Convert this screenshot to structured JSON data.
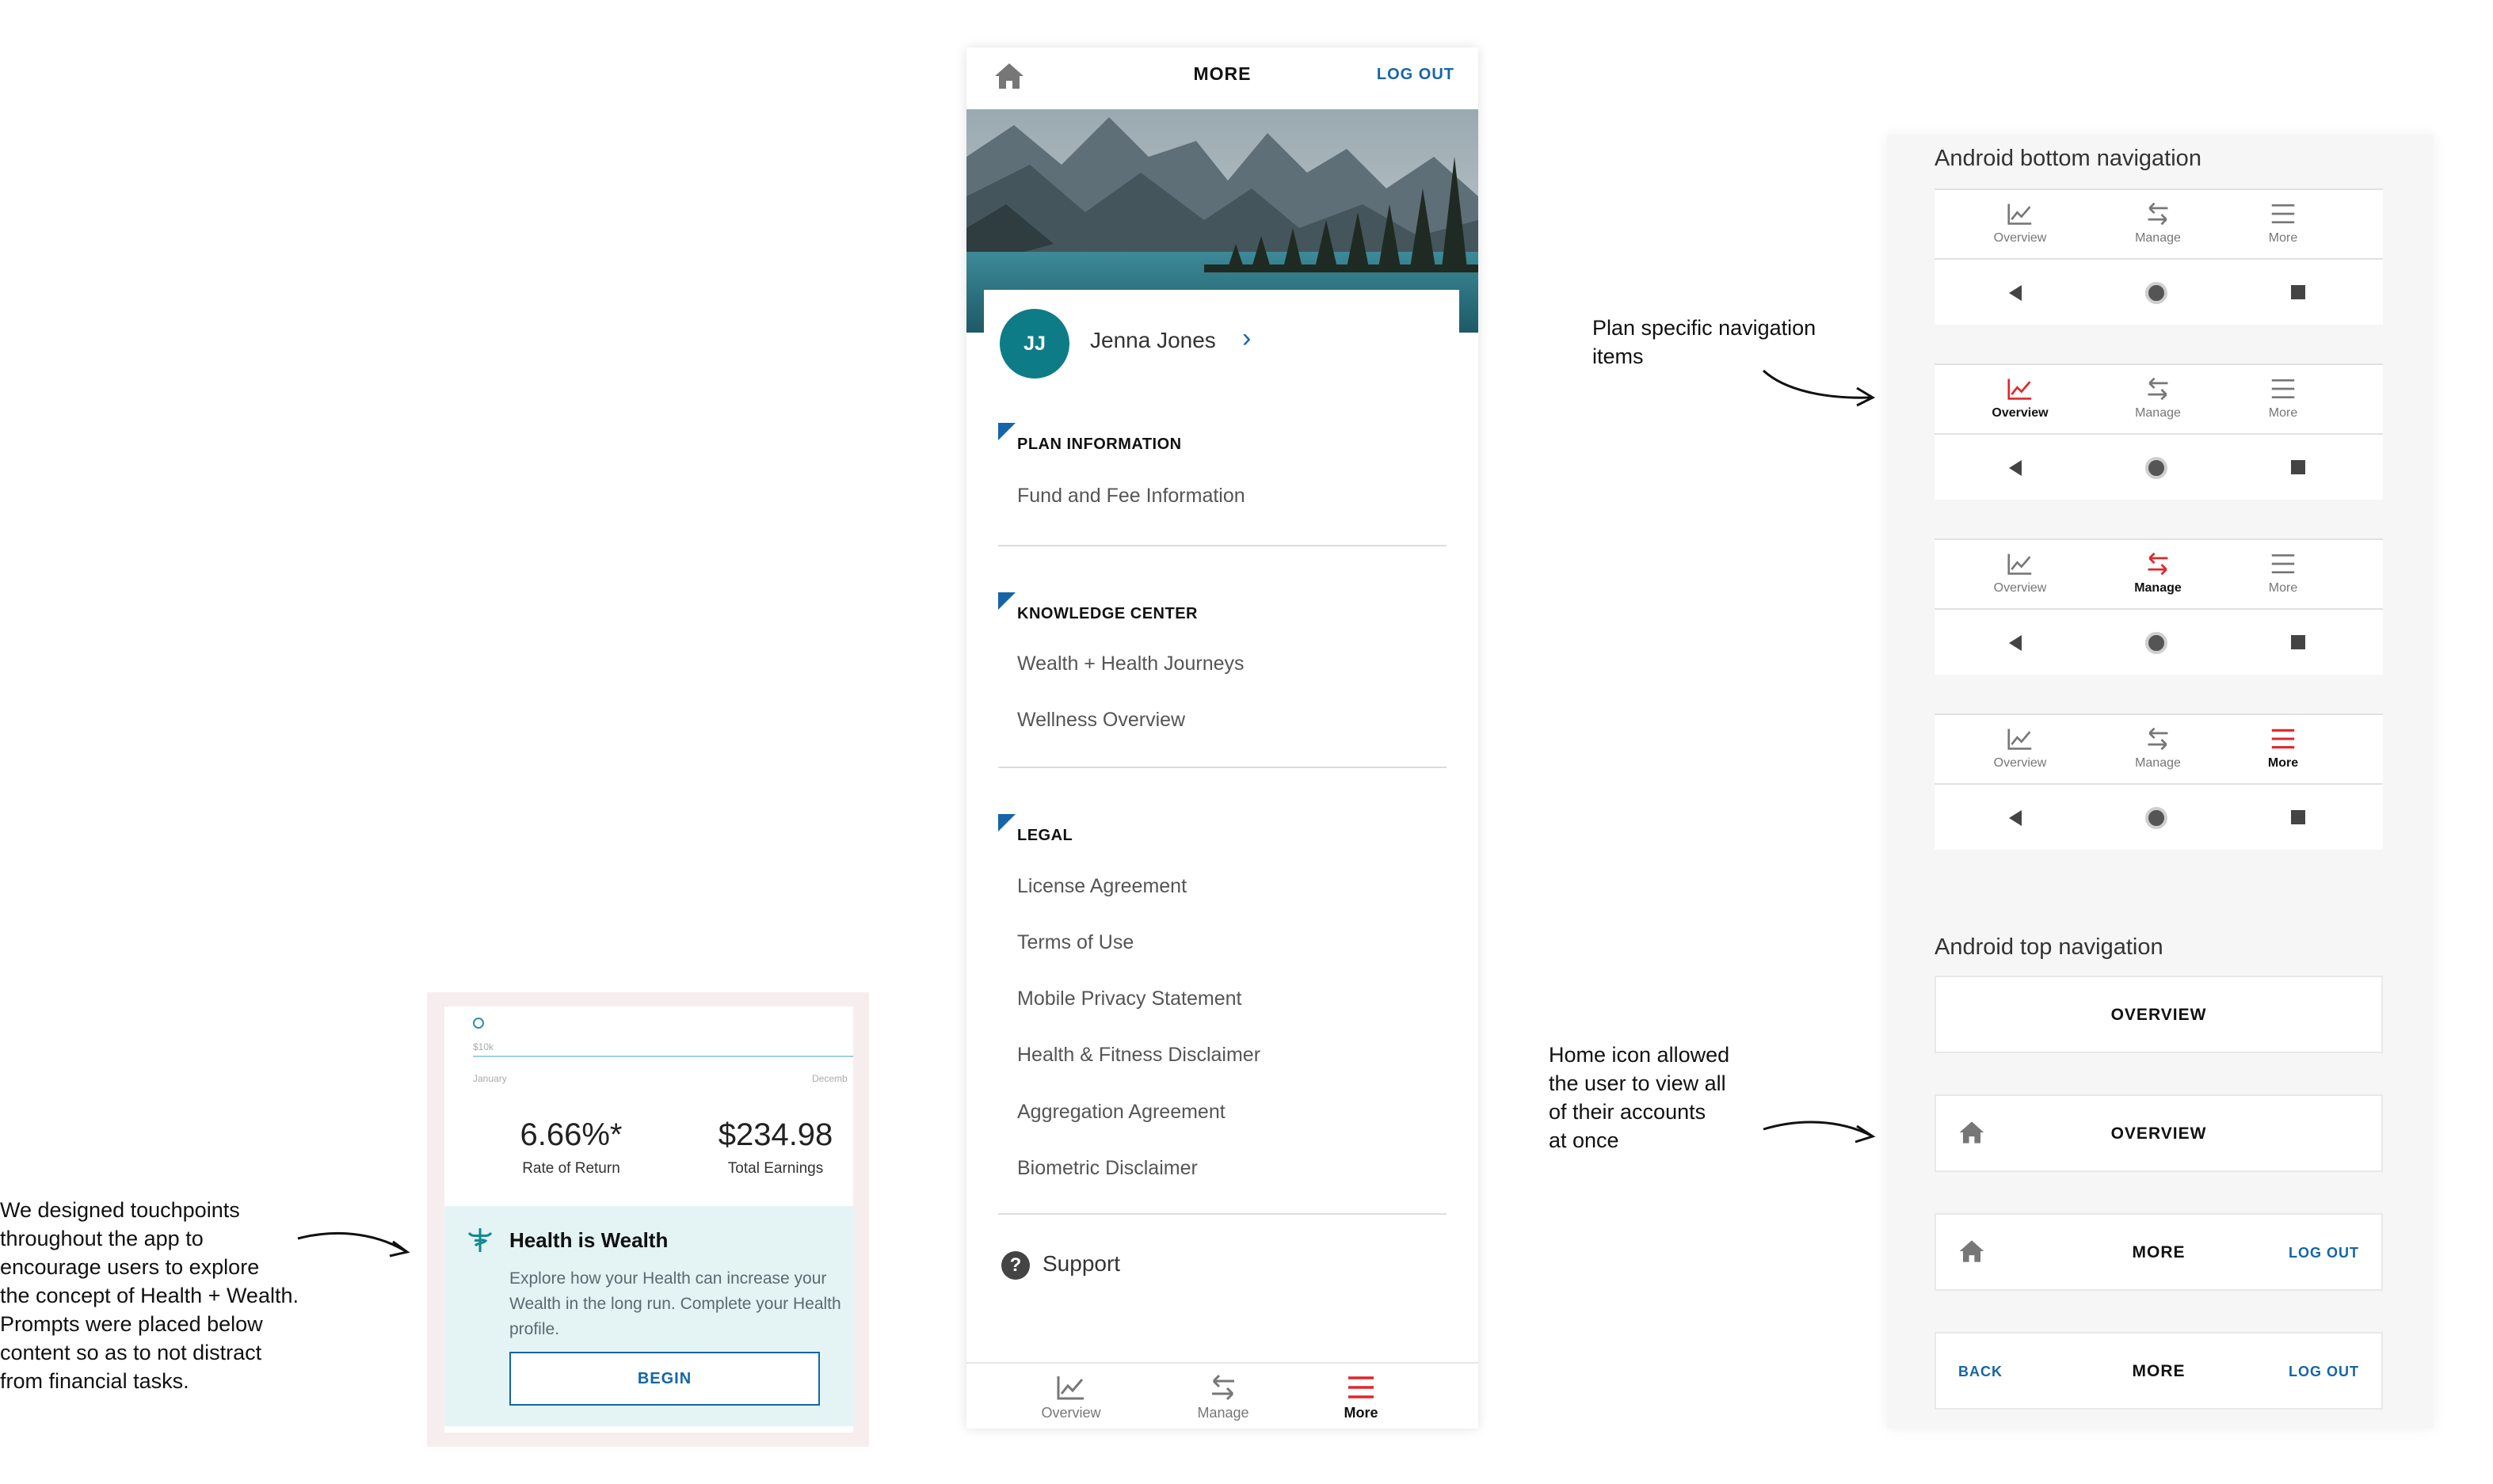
{
  "annotations": {
    "touchpoints": "We designed touchpoints\nthroughout the app to\nencourage users to explore\nthe concept of Health + Wealth.\nPrompts were placed below\ncontent so as to not distract\nfrom financial tasks.",
    "plan_nav": "Plan specific navigation\nitems",
    "home_icon": "Home icon allowed\nthe user to view all\nof their accounts\nat once"
  },
  "health_card": {
    "chart_y_tick": "$10k",
    "chart_x_start": "January",
    "chart_x_end": "Decemb",
    "rate_value": "6.66%*",
    "rate_label": "Rate of Return",
    "earnings_value": "$234.98",
    "earnings_label": "Total Earnings",
    "icon": "caduceus-icon",
    "title": "Health is Wealth",
    "body": "Explore how your Health can increase your Wealth in the long run. Complete your Health profile.",
    "button": "BEGIN"
  },
  "phone": {
    "title": "MORE",
    "logout": "LOG OUT",
    "profile": {
      "initials": "JJ",
      "name": "Jenna Jones"
    },
    "sections": [
      {
        "heading": "PLAN INFORMATION",
        "items": [
          "Fund and Fee Information"
        ]
      },
      {
        "heading": "KNOWLEDGE CENTER",
        "items": [
          "Wealth + Health Journeys",
          "Wellness Overview"
        ]
      },
      {
        "heading": "LEGAL",
        "items": [
          "License Agreement",
          "Terms of Use",
          "Mobile Privacy Statement",
          "Health & Fitness Disclaimer",
          "Aggregation Agreement",
          "Biometric Disclaimer"
        ]
      }
    ],
    "support": "Support",
    "bottom_nav": [
      {
        "label": "Overview",
        "active": false
      },
      {
        "label": "Manage",
        "active": false
      },
      {
        "label": "More",
        "active": true
      }
    ]
  },
  "right_panel": {
    "bottom_heading": "Android bottom navigation",
    "top_heading": "Android top navigation",
    "nav_labels": [
      "Overview",
      "Manage",
      "More"
    ],
    "bottom_variants_active": [
      -1,
      0,
      1,
      2
    ],
    "top_variants": [
      {
        "title": "OVERVIEW"
      },
      {
        "title": "OVERVIEW"
      },
      {
        "title": "MORE",
        "logout": "LOG OUT"
      },
      {
        "back": "BACK",
        "title": "MORE",
        "logout": "LOG OUT"
      }
    ]
  },
  "colors": {
    "accent_blue": "#1565a8",
    "active_red": "#e0262a",
    "teal": "#0e7c86",
    "health_panel": "#e4f4f5"
  }
}
